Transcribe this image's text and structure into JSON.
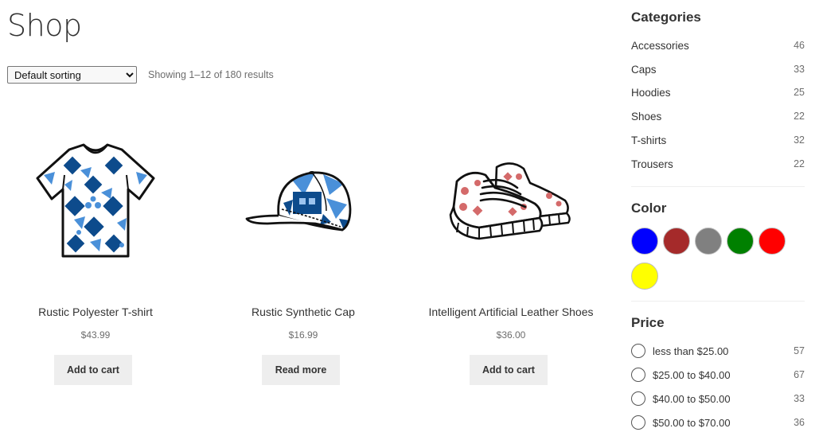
{
  "shop": {
    "title": "Shop",
    "sorting": {
      "selected": "Default sorting",
      "options": [
        "Default sorting"
      ]
    },
    "result_count": "Showing 1–12 of 180 results"
  },
  "products": [
    {
      "title": "Rustic Polyester T-shirt",
      "price": "$43.99",
      "button": "Add to cart",
      "icon": "tshirt-icon"
    },
    {
      "title": "Rustic Synthetic Cap",
      "price": "$16.99",
      "button": "Read more",
      "icon": "cap-icon"
    },
    {
      "title": "Intelligent Artificial Leather Shoes",
      "price": "$36.00",
      "button": "Add to cart",
      "icon": "shoes-icon"
    }
  ],
  "sidebar": {
    "categories": {
      "title": "Categories",
      "items": [
        {
          "name": "Accessories",
          "count": "46"
        },
        {
          "name": "Caps",
          "count": "33"
        },
        {
          "name": "Hoodies",
          "count": "25"
        },
        {
          "name": "Shoes",
          "count": "22"
        },
        {
          "name": "T-shirts",
          "count": "32"
        },
        {
          "name": "Trousers",
          "count": "22"
        }
      ]
    },
    "color": {
      "title": "Color",
      "swatches": [
        {
          "name": "blue",
          "hex": "#0000ff"
        },
        {
          "name": "brown",
          "hex": "#a52a2a"
        },
        {
          "name": "gray",
          "hex": "#808080"
        },
        {
          "name": "green",
          "hex": "#008000"
        },
        {
          "name": "red",
          "hex": "#ff0000"
        },
        {
          "name": "yellow",
          "hex": "#ffff00"
        }
      ]
    },
    "price": {
      "title": "Price",
      "items": [
        {
          "label": "less than $25.00",
          "count": "57"
        },
        {
          "label": "$25.00 to $40.00",
          "count": "67"
        },
        {
          "label": "$40.00 to $50.00",
          "count": "33"
        },
        {
          "label": "$50.00 to $70.00",
          "count": "36"
        }
      ]
    }
  }
}
